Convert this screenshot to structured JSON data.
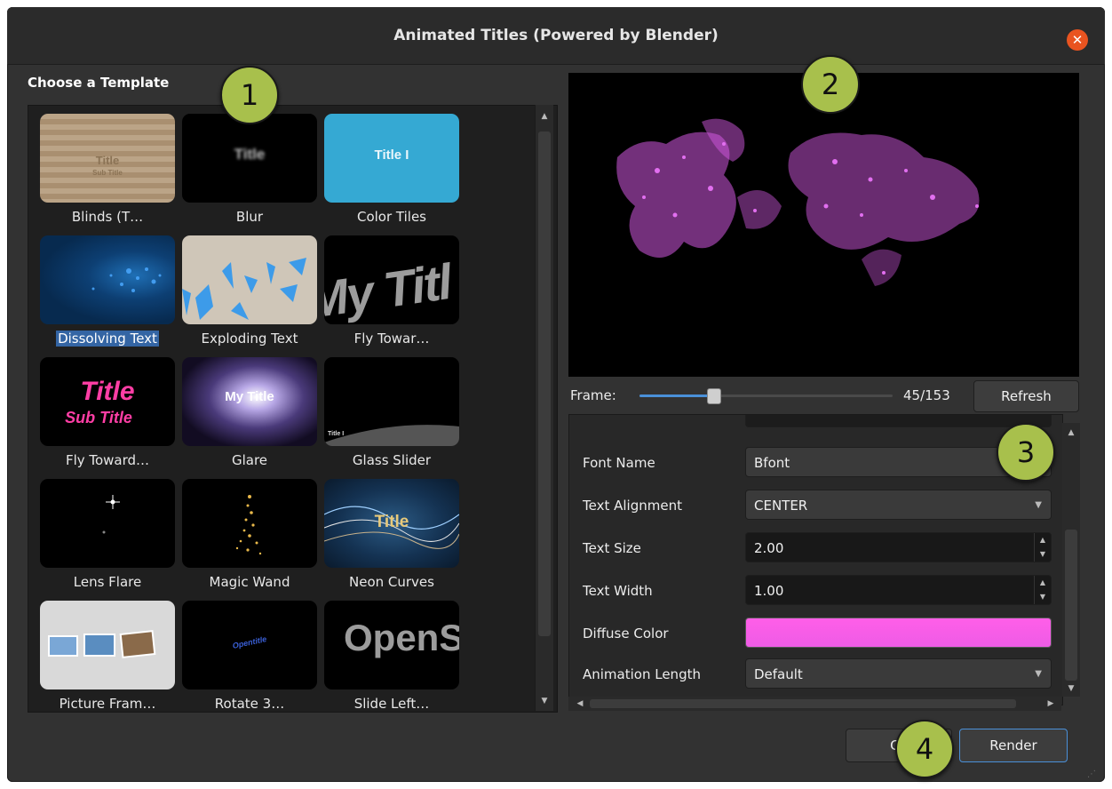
{
  "window": {
    "title": "Animated Titles (Powered by Blender)"
  },
  "templates": {
    "section_label": "Choose a Template",
    "items": [
      {
        "label": "Blinds (T…",
        "thumb_text": "Title",
        "thumb_sub": "Sub Title"
      },
      {
        "label": "Blur",
        "thumb_text": "Title"
      },
      {
        "label": "Color Tiles",
        "thumb_text": "Title I"
      },
      {
        "label": "Dissolving Text",
        "selected": true
      },
      {
        "label": "Exploding Text"
      },
      {
        "label": "Fly Towar…",
        "thumb_text": "My Titl"
      },
      {
        "label": "Fly Toward…",
        "thumb_text": "Title",
        "thumb_sub": "Sub Title"
      },
      {
        "label": "Glare",
        "thumb_text": "My Title"
      },
      {
        "label": "Glass Slider",
        "thumb_text": "Title I"
      },
      {
        "label": "Lens Flare"
      },
      {
        "label": "Magic Wand"
      },
      {
        "label": "Neon Curves",
        "thumb_text": "Title"
      },
      {
        "label": "Picture Fram…"
      },
      {
        "label": "Rotate 3…",
        "thumb_text": "Opentitle"
      },
      {
        "label": "Slide Left…",
        "thumb_text": "OpenSh"
      }
    ]
  },
  "preview": {
    "frame_label": "Frame:",
    "frame_counter": "45/153",
    "frame_progress": 0.29,
    "refresh_label": "Refresh"
  },
  "properties": [
    {
      "label": "Font Name",
      "value": "Bfont",
      "type": "combo"
    },
    {
      "label": "Text Alignment",
      "value": "CENTER",
      "type": "combo"
    },
    {
      "label": "Text Size",
      "value": "2.00",
      "type": "spin"
    },
    {
      "label": "Text Width",
      "value": "1.00",
      "type": "spin"
    },
    {
      "label": "Diffuse Color",
      "value": "",
      "type": "color",
      "color": "#ff5ee8"
    },
    {
      "label": "Animation Length",
      "value": "Default",
      "type": "combo"
    }
  ],
  "buttons": {
    "cancel_label": "Ca",
    "render_label": "Render"
  },
  "callouts": [
    "1",
    "2",
    "3",
    "4"
  ],
  "colors": {
    "accent": "#3465a4",
    "particle": "#d158e0",
    "callout": "#a8c04c",
    "close": "#e95420"
  },
  "icons": [
    "close-icon",
    "chevron-down-icon",
    "chevron-up-icon",
    "resize-grip-icon"
  ]
}
